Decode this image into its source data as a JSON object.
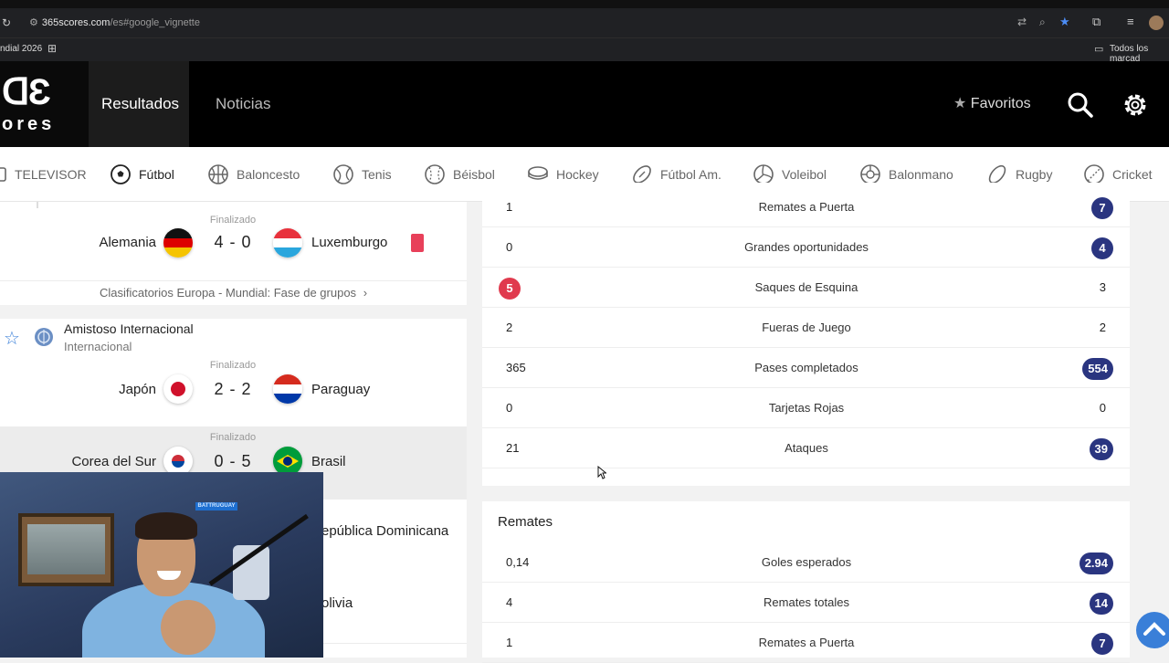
{
  "browser": {
    "url_domain": "365scores.com",
    "url_path": "/es#google_vignette",
    "bookmark_left": "ndial 2026",
    "bookmark_right": "Todos los marcad"
  },
  "header": {
    "logo_top": "ᗡƐ",
    "logo_bottom": "ores",
    "nav": [
      "Resultados",
      "Noticias"
    ],
    "favorites_label": "Favoritos"
  },
  "sports": [
    "TELEVISOR",
    "Fútbol",
    "Baloncesto",
    "Tenis",
    "Béisbol",
    "Hockey",
    "Fútbol Am.",
    "Voleibol",
    "Balonmano",
    "Rugby",
    "Cricket"
  ],
  "matches": [
    {
      "status": "Finalizado",
      "home": "Alemania",
      "score": "4 - 0",
      "away": "Luxemburgo"
    },
    {
      "status": "Finalizado",
      "home": "Japón",
      "score": "2 - 2",
      "away": "Paraguay"
    },
    {
      "status": "Finalizado",
      "home": "Corea del Sur",
      "score": "0 - 5",
      "away": "Brasil"
    }
  ],
  "competition_link": "Clasificatorios Europa - Mundial: Fase de grupos",
  "competition_header": {
    "title": "Amistoso Internacional",
    "subtitle": "Internacional"
  },
  "partial_rows": {
    "team_a": "epública Dominicana",
    "team_b": "olivia"
  },
  "stats_general": [
    {
      "name": "Remates a Puerta",
      "home": "1",
      "away": "7",
      "highlight": "away"
    },
    {
      "name": "Grandes oportunidades",
      "home": "0",
      "away": "4",
      "highlight": "away"
    },
    {
      "name": "Saques de Esquina",
      "home": "5",
      "away": "3",
      "highlight": "home"
    },
    {
      "name": "Fueras de Juego",
      "home": "2",
      "away": "2",
      "highlight": "none"
    },
    {
      "name": "Pases completados",
      "home": "365",
      "away": "554",
      "highlight": "away"
    },
    {
      "name": "Tarjetas Rojas",
      "home": "0",
      "away": "0",
      "highlight": "none"
    },
    {
      "name": "Ataques",
      "home": "21",
      "away": "39",
      "highlight": "away"
    }
  ],
  "section_remates": "Remates",
  "stats_remates": [
    {
      "name": "Goles esperados",
      "home": "0,14",
      "away": "2.94",
      "highlight": "away"
    },
    {
      "name": "Remates totales",
      "home": "4",
      "away": "14",
      "highlight": "away"
    },
    {
      "name": "Remates a Puerta",
      "home": "1",
      "away": "7",
      "highlight": "away"
    }
  ],
  "webcam_sign": "BATTRUGUAY",
  "colors": {
    "highlight_blue": "#2a3580",
    "highlight_red": "#e03a4e",
    "header_bg": "#000000"
  }
}
